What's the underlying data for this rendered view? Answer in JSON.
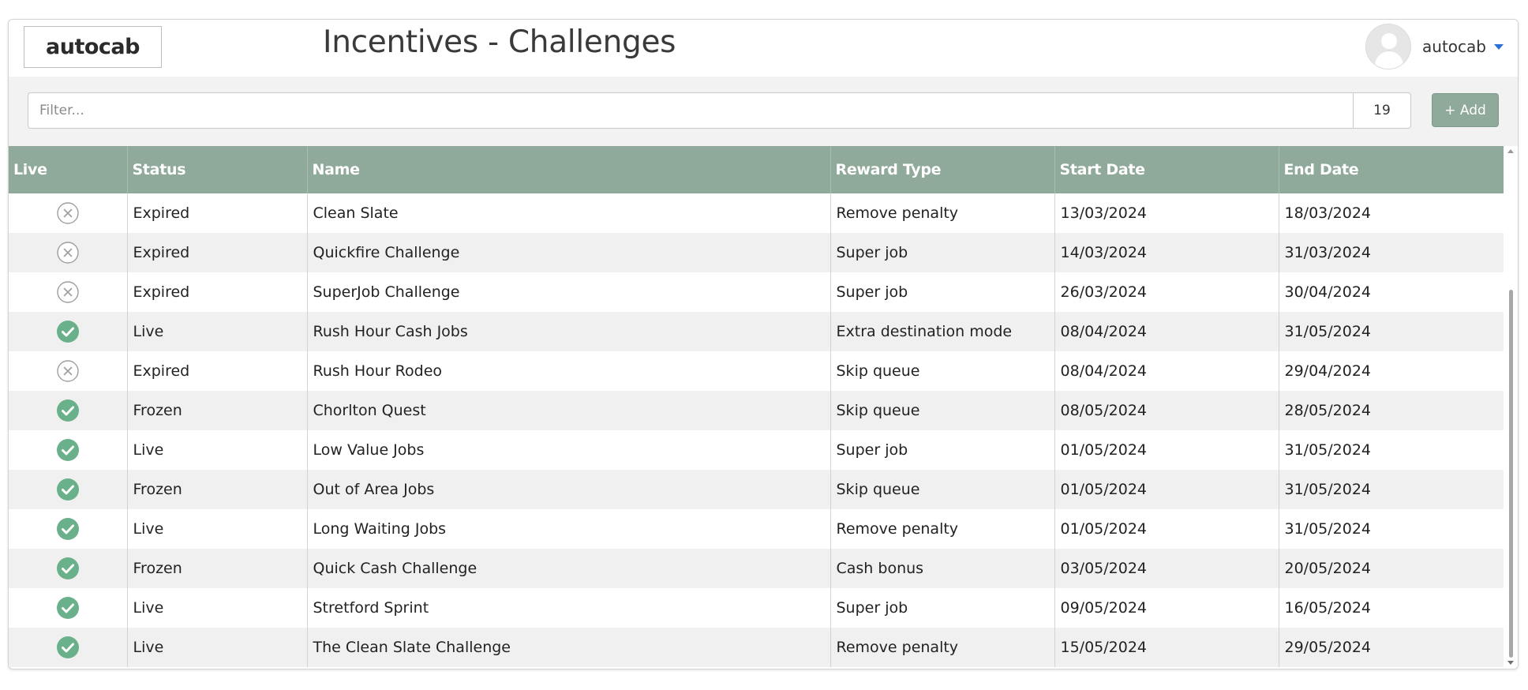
{
  "header": {
    "logo_text": "autocab",
    "title": "Incentives - Challenges",
    "user": {
      "name": "autocab",
      "avatar_icon": "user-avatar-icon",
      "menu_icon": "caret-down-icon"
    }
  },
  "toolbar": {
    "filter_placeholder": "Filter...",
    "filter_value": "",
    "count": "19",
    "add_label": "+ Add"
  },
  "colors": {
    "header_bg": "#8fa99a",
    "live_green": "#6ab08a",
    "inactive_grey": "#9e9e9e",
    "caret_blue": "#2a6fd6"
  },
  "table": {
    "columns": [
      "Live",
      "Status",
      "Name",
      "Reward Type",
      "Start Date",
      "End Date"
    ],
    "rows": [
      {
        "live": false,
        "status": "Expired",
        "name": "Clean Slate",
        "reward_type": "Remove penalty",
        "start_date": "13/03/2024",
        "end_date": "18/03/2024"
      },
      {
        "live": false,
        "status": "Expired",
        "name": "Quickfire Challenge",
        "reward_type": "Super job",
        "start_date": "14/03/2024",
        "end_date": "31/03/2024"
      },
      {
        "live": false,
        "status": "Expired",
        "name": "SuperJob Challenge",
        "reward_type": "Super job",
        "start_date": "26/03/2024",
        "end_date": "30/04/2024"
      },
      {
        "live": true,
        "status": "Live",
        "name": "Rush Hour Cash Jobs",
        "reward_type": "Extra destination mode",
        "start_date": "08/04/2024",
        "end_date": "31/05/2024"
      },
      {
        "live": false,
        "status": "Expired",
        "name": "Rush Hour Rodeo",
        "reward_type": "Skip queue",
        "start_date": "08/04/2024",
        "end_date": "29/04/2024"
      },
      {
        "live": true,
        "status": "Frozen",
        "name": "Chorlton Quest",
        "reward_type": "Skip queue",
        "start_date": "08/05/2024",
        "end_date": "28/05/2024"
      },
      {
        "live": true,
        "status": "Live",
        "name": "Low Value Jobs",
        "reward_type": "Super job",
        "start_date": "01/05/2024",
        "end_date": "31/05/2024"
      },
      {
        "live": true,
        "status": "Frozen",
        "name": "Out of Area Jobs",
        "reward_type": "Skip queue",
        "start_date": "01/05/2024",
        "end_date": "31/05/2024"
      },
      {
        "live": true,
        "status": "Live",
        "name": "Long Waiting Jobs",
        "reward_type": "Remove penalty",
        "start_date": "01/05/2024",
        "end_date": "31/05/2024"
      },
      {
        "live": true,
        "status": "Frozen",
        "name": "Quick Cash Challenge",
        "reward_type": "Cash bonus",
        "start_date": "03/05/2024",
        "end_date": "20/05/2024"
      },
      {
        "live": true,
        "status": "Live",
        "name": "Stretford Sprint",
        "reward_type": "Super job",
        "start_date": "09/05/2024",
        "end_date": "16/05/2024"
      },
      {
        "live": true,
        "status": "Live",
        "name": "The Clean Slate Challenge",
        "reward_type": "Remove penalty",
        "start_date": "15/05/2024",
        "end_date": "29/05/2024"
      }
    ]
  }
}
